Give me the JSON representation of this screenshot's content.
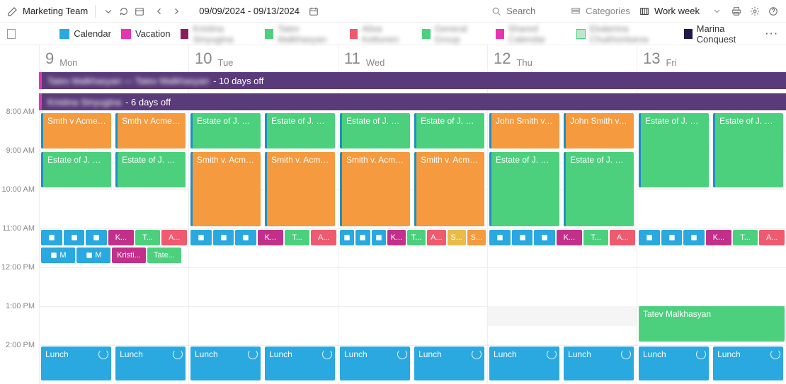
{
  "toolbar": {
    "calendar_name": "Marketing Team",
    "date_range": "09/09/2024 - 09/13/2024",
    "search_placeholder": "Search",
    "categories_label": "Categories",
    "view_label": "Work week"
  },
  "legend": {
    "items": [
      {
        "label": "Calendar",
        "color": "#2aa8e0"
      },
      {
        "label": "Vacation",
        "color": "#e535b3"
      },
      {
        "label": "Kristina Sinyugina",
        "color": "#8a1e5a",
        "blurred": true
      },
      {
        "label": "Tatev Malkhasyan",
        "color": "#4cd07d",
        "blurred": true
      },
      {
        "label": "Alisa Kettunen",
        "color": "#ef5a6f",
        "blurred": true
      },
      {
        "label": "General Group",
        "color": "#4cd07d",
        "blurred": true
      },
      {
        "label": "Shared Calendar",
        "color": "#e535b3",
        "blurred": true
      },
      {
        "label": "Ekaterina Chukhontseva",
        "color": "#bfe6cc",
        "blurred": true
      },
      {
        "label": "Marina Conquest",
        "color": "#1f1a4a"
      }
    ]
  },
  "days": [
    {
      "num": "9",
      "name": "Mon"
    },
    {
      "num": "10",
      "name": "Tue"
    },
    {
      "num": "11",
      "name": "Wed"
    },
    {
      "num": "12",
      "name": "Thu"
    },
    {
      "num": "13",
      "name": "Fri"
    }
  ],
  "hours": [
    "8:00 AM",
    "9:00 AM",
    "10:00 AM",
    "11:00 AM",
    "12:00 PM",
    "1:00 PM",
    "2:00 PM"
  ],
  "allday": [
    {
      "blurred_name": "Tatev Malkhasyan — Tatev Malkhasyan",
      "suffix": " - 10 days off",
      "color": "#5a3b7a",
      "accent": "#e535b3"
    },
    {
      "blurred_name": "Kristina Sinyugina",
      "suffix": " - 6 days off",
      "color": "#5a3b7a",
      "accent": "#e535b3"
    }
  ],
  "events_text": {
    "smth_acme": "Smth v Acme: ...",
    "estate": "Estate of J. Do...",
    "smith_acme": "Smith v. Acme:...",
    "john_smith": "John Smith v. ...",
    "lunch": "Lunch",
    "tatev": "Tatev Malkhasyan",
    "kristi": "Kristi...",
    "tate": "Tate...",
    "k": "K...",
    "t": "T...",
    "a": "A...",
    "s": "S...",
    "m": "M"
  },
  "colors": {
    "blue": "#2aa8e0",
    "green": "#4cd07d",
    "orange": "#f59a3e",
    "magenta": "#c2308a",
    "red": "#ef5a6f",
    "purple": "#5a3b7a",
    "pink": "#e535b3",
    "darknavy": "#1f1a4a",
    "yellow": "#e8bb4a"
  }
}
